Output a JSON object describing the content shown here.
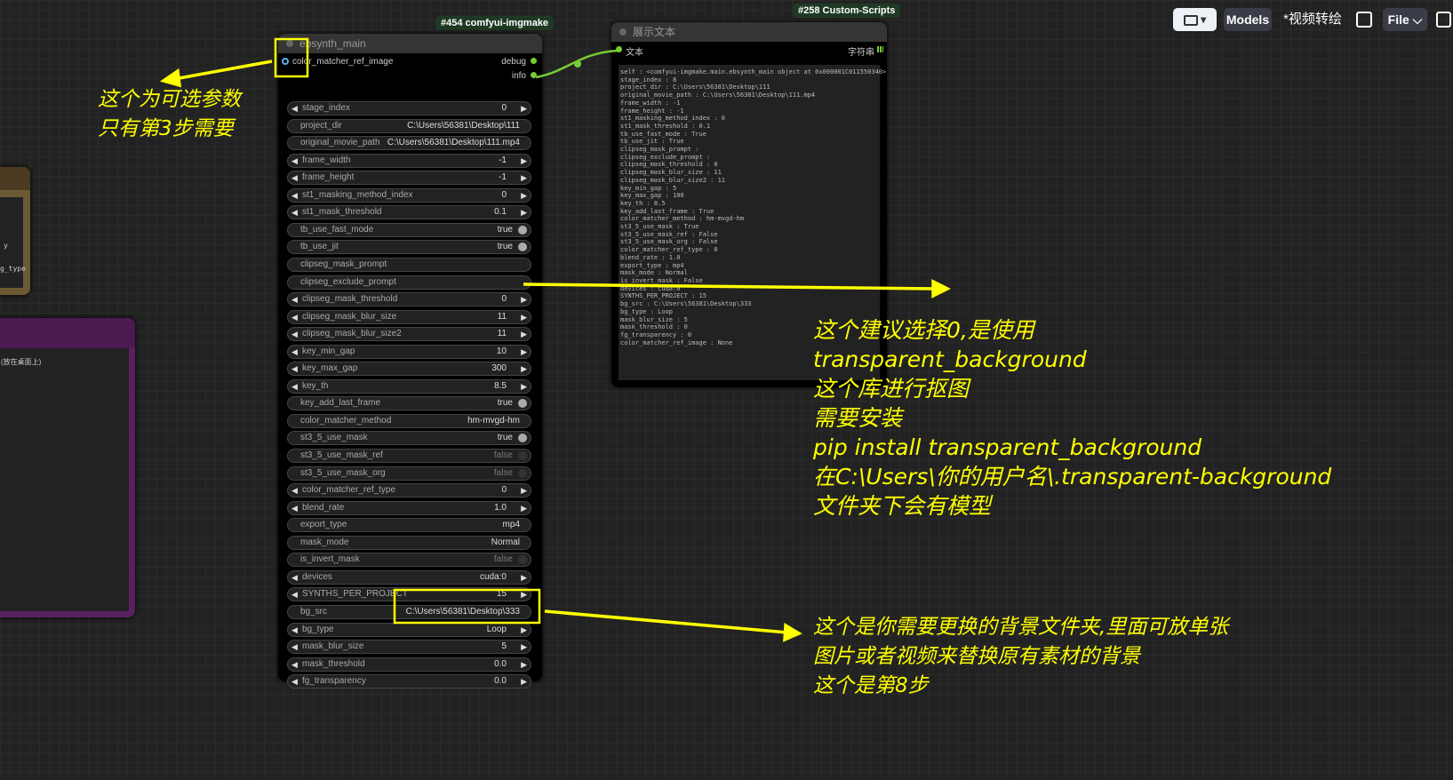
{
  "toolbar": {
    "folder_icon": "folder-icon",
    "models": "Models",
    "workflow_title": "*视频转绘",
    "image_icon": "image-icon",
    "file": "File",
    "save_icon": "save-icon"
  },
  "left_nodes": {
    "brown_snippets": [
      "y",
      "g_type"
    ],
    "purple_snippet": "(放在桌面上)"
  },
  "main_node": {
    "badge": "#454 comfyui-imgmake",
    "title": "ebsynth_main",
    "input": "color_matcher_ref_image",
    "outputs": [
      "debug",
      "info"
    ],
    "widgets": [
      {
        "name": "stage_index",
        "value": "0",
        "kind": "number"
      },
      {
        "name": "project_dir",
        "value": "C:\\Users\\56381\\Desktop\\111",
        "kind": "text"
      },
      {
        "name": "original_movie_path",
        "value": "C:\\Users\\56381\\Desktop\\111.mp4",
        "kind": "text"
      },
      {
        "name": "frame_width",
        "value": "-1",
        "kind": "number"
      },
      {
        "name": "frame_height",
        "value": "-1",
        "kind": "number"
      },
      {
        "name": "st1_masking_method_index",
        "value": "0",
        "kind": "number"
      },
      {
        "name": "st1_mask_threshold",
        "value": "0.1",
        "kind": "number"
      },
      {
        "name": "tb_use_fast_mode",
        "value": "true",
        "kind": "toggle"
      },
      {
        "name": "tb_use_jit",
        "value": "true",
        "kind": "toggle"
      },
      {
        "name": "clipseg_mask_prompt",
        "value": "",
        "kind": "text"
      },
      {
        "name": "clipseg_exclude_prompt",
        "value": "",
        "kind": "text"
      },
      {
        "name": "clipseg_mask_threshold",
        "value": "0",
        "kind": "number"
      },
      {
        "name": "clipseg_mask_blur_size",
        "value": "11",
        "kind": "number"
      },
      {
        "name": "clipseg_mask_blur_size2",
        "value": "11",
        "kind": "number"
      },
      {
        "name": "key_min_gap",
        "value": "10",
        "kind": "number"
      },
      {
        "name": "key_max_gap",
        "value": "300",
        "kind": "number"
      },
      {
        "name": "key_th",
        "value": "8.5",
        "kind": "number"
      },
      {
        "name": "key_add_last_frame",
        "value": "true",
        "kind": "toggle"
      },
      {
        "name": "color_matcher_method",
        "value": "hm-mvgd-hm",
        "kind": "text"
      },
      {
        "name": "st3_5_use_mask",
        "value": "true",
        "kind": "toggle"
      },
      {
        "name": "st3_5_use_mask_ref",
        "value": "false",
        "kind": "toggle"
      },
      {
        "name": "st3_5_use_mask_org",
        "value": "false",
        "kind": "toggle"
      },
      {
        "name": "color_matcher_ref_type",
        "value": "0",
        "kind": "number"
      },
      {
        "name": "blend_rate",
        "value": "1.0",
        "kind": "number"
      },
      {
        "name": "export_type",
        "value": "mp4",
        "kind": "text"
      },
      {
        "name": "mask_mode",
        "value": "Normal",
        "kind": "text"
      },
      {
        "name": "is_invert_mask",
        "value": "false",
        "kind": "toggle"
      },
      {
        "name": "devices",
        "value": "cuda:0",
        "kind": "number"
      },
      {
        "name": "SYNTHS_PER_PROJECT",
        "value": "15",
        "kind": "number"
      },
      {
        "name": "bg_src",
        "value": "C:\\Users\\56381\\Desktop\\333",
        "kind": "text"
      },
      {
        "name": "bg_type",
        "value": "Loop",
        "kind": "number"
      },
      {
        "name": "mask_blur_size",
        "value": "5",
        "kind": "number"
      },
      {
        "name": "mask_threshold",
        "value": "0.0",
        "kind": "number"
      },
      {
        "name": "fg_transparency",
        "value": "0.0",
        "kind": "number"
      }
    ]
  },
  "text_node": {
    "badge": "#258 Custom-Scripts",
    "title": "展示文本",
    "input": "文本",
    "output": "字符串",
    "content": "self : <comfyui-imgmake.main.ebsynth_main object at 0x000001C011550340>\nstage_index : 8\nproject_dir : C:\\Users\\56381\\Desktop\\111\noriginal_movie_path : C:\\Users\\56381\\Desktop\\111.mp4\nframe_width : -1\nframe_height : -1\nst1_masking_method_index : 0\nst1_mask_threshold : 0.1\ntb_use_fast_mode : True\ntb_use_jit : True\nclipseg_mask_prompt :\nclipseg_exclude_prompt :\nclipseg_mask_threshold : 0\nclipseg_mask_blur_size : 11\nclipseg_mask_blur_size2 : 11\nkey_min_gap : 5\nkey_max_gap : 100\nkey_th : 8.5\nkey_add_last_frame : True\ncolor_matcher_method : hm-mvgd-hm\nst3_5_use_mask : True\nst3_5_use_mask_ref : False\nst3_5_use_mask_org : False\ncolor_matcher_ref_type : 0\nblend_rate : 1.0\nexport_type : mp4\nmask_mode : Normal\nis_invert_mask : False\ndevices : cuda:0\nSYNTHS_PER_PROJECT : 15\nbg_src : C:\\Users\\56381\\Desktop\\333\nbg_type : Loop\nmask_blur_size : 5\nmask_threshold : 0\nfg_transparency : 0\ncolor_matcher_ref_image : None"
  },
  "annotations": {
    "optional": [
      "这个为可选参数",
      "只有第3步需要"
    ],
    "threshold": [
      "这个建议选择0,是使用",
      "transparent_background",
      "这个库进行抠图",
      "需要安装",
      "pip install transparent_background",
      "在C:\\Users\\你的用户名\\.transparent-background",
      "文件夹下会有模型"
    ],
    "bg": [
      "这个是你需要更换的背景文件夹,里面可放单张",
      "图片或者视频来替换原有素材的背景",
      "这个是第8步"
    ]
  },
  "colors": {
    "annotation": "#ffff00",
    "link": "#7c3",
    "input_slot": "#5ab0f0"
  }
}
